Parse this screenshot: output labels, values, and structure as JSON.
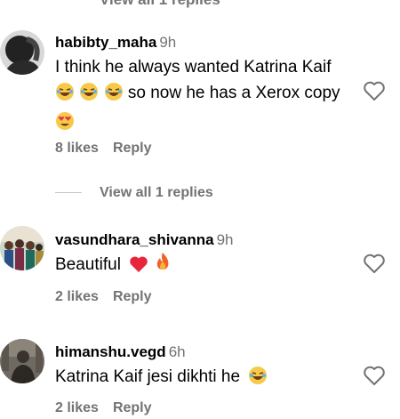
{
  "top_cut_text": "View all 1 replies",
  "comments": [
    {
      "username": "habibty_maha",
      "time": "9h",
      "text_parts": [
        "I think he always wanted Katrina Kaif",
        "so now he has a Xerox copy"
      ],
      "likes": "8 likes",
      "reply": "Reply",
      "view_replies": "View all 1 replies"
    },
    {
      "username": "vasundhara_shivanna",
      "time": "9h",
      "text": "Beautiful",
      "likes": "2 likes",
      "reply": "Reply"
    },
    {
      "username": "himanshu.vegd",
      "time": "6h",
      "text": "Katrina Kaif jesi dikhti he",
      "likes": "2 likes",
      "reply": "Reply"
    }
  ]
}
